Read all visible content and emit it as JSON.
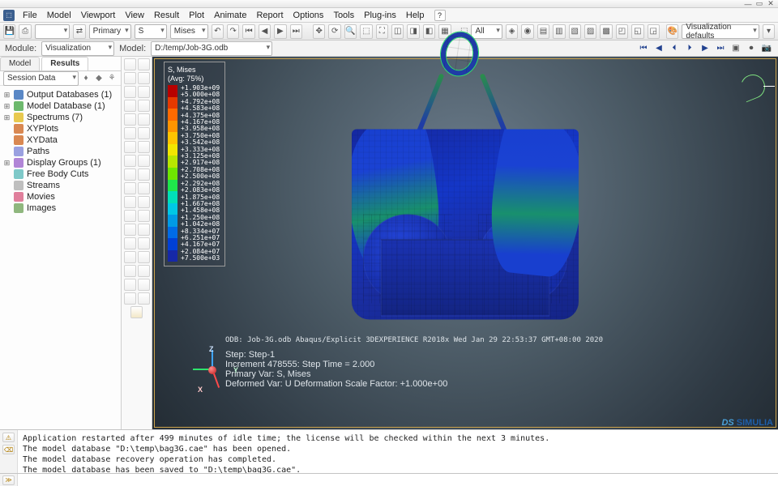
{
  "menu": {
    "items": [
      "File",
      "Model",
      "Viewport",
      "View",
      "Result",
      "Plot",
      "Animate",
      "Report",
      "Options",
      "Tools",
      "Plug-ins",
      "Help"
    ]
  },
  "ctx": {
    "combo1": "",
    "primary": "Primary",
    "varS": "S",
    "mises": "Mises",
    "all": "All",
    "vizdefaults": "Visualization defaults"
  },
  "mod": {
    "module_lbl": "Module:",
    "module_val": "Visualization",
    "model_lbl": "Model:",
    "model_val": "D:/temp/Job-3G.odb"
  },
  "tabs": {
    "t1": "Model",
    "t2": "Results"
  },
  "session": {
    "combo": "Session Data"
  },
  "tree": [
    {
      "exp": "⊞",
      "icn": "ic-db",
      "label": "Output Databases (1)"
    },
    {
      "exp": "⊞",
      "icn": "ic-md",
      "label": "Model Database (1)"
    },
    {
      "exp": "⊞",
      "icn": "ic-sp",
      "label": "Spectrums (7)"
    },
    {
      "exp": "",
      "icn": "ic-xy",
      "label": "XYPlots"
    },
    {
      "exp": "",
      "icn": "ic-xy",
      "label": "XYData"
    },
    {
      "exp": "",
      "icn": "ic-pt",
      "label": "Paths"
    },
    {
      "exp": "⊞",
      "icn": "ic-dg",
      "label": "Display Groups (1)"
    },
    {
      "exp": "",
      "icn": "ic-fb",
      "label": "Free Body Cuts"
    },
    {
      "exp": "",
      "icn": "ic-st",
      "label": "Streams"
    },
    {
      "exp": "",
      "icn": "ic-mv",
      "label": "Movies"
    },
    {
      "exp": "",
      "icn": "ic-im",
      "label": "Images"
    }
  ],
  "legend": {
    "title1": "S, Mises",
    "title2": "(Avg: 75%)",
    "colors": [
      "#b80000",
      "#e53900",
      "#ff6a00",
      "#ff9400",
      "#ffc400",
      "#f2e600",
      "#b8e600",
      "#6fe600",
      "#1fe64b",
      "#00e0b8",
      "#00c8e6",
      "#009be6",
      "#006be6",
      "#0040d6",
      "#1628a8"
    ],
    "values": [
      "+1.903e+09",
      "+5.000e+08",
      "+4.792e+08",
      "+4.583e+08",
      "+4.375e+08",
      "+4.167e+08",
      "+3.958e+08",
      "+3.750e+08",
      "+3.542e+08",
      "+3.333e+08",
      "+3.125e+08",
      "+2.917e+08",
      "+2.708e+08",
      "+2.500e+08",
      "+2.292e+08",
      "+2.083e+08",
      "+1.875e+08",
      "+1.667e+08",
      "+1.458e+08",
      "+1.250e+08",
      "+1.042e+08",
      "+8.334e+07",
      "+6.251e+07",
      "+4.167e+07",
      "+2.084e+07",
      "+7.500e+03"
    ]
  },
  "odb_line": "ODB: Job-3G.odb    Abaqus/Explicit 3DEXPERIENCE R2018x    Wed Jan 29 22:53:37 GMT+08:00 2020",
  "step": {
    "l1": "Step: Step-1",
    "l2": "Increment    478555: Step Time =    2.000",
    "l3": "Primary Var: S, Mises",
    "l4": "Deformed Var: U   Deformation Scale Factor: +1.000e+00"
  },
  "triad": {
    "x": "X",
    "y": "Y",
    "z": "Z"
  },
  "brand": {
    "ds": "DS",
    "name": "SIMULIA"
  },
  "log": "Application restarted after 499 minutes of idle time; the license will be checked within the next 3 minutes.\nThe model database \"D:\\temp\\bag3G.cae\" has been opened.\nThe model database recovery operation has completed.\nThe model database has been saved to \"D:\\temp\\bag3G.cae\".",
  "cli_placeholder": ""
}
